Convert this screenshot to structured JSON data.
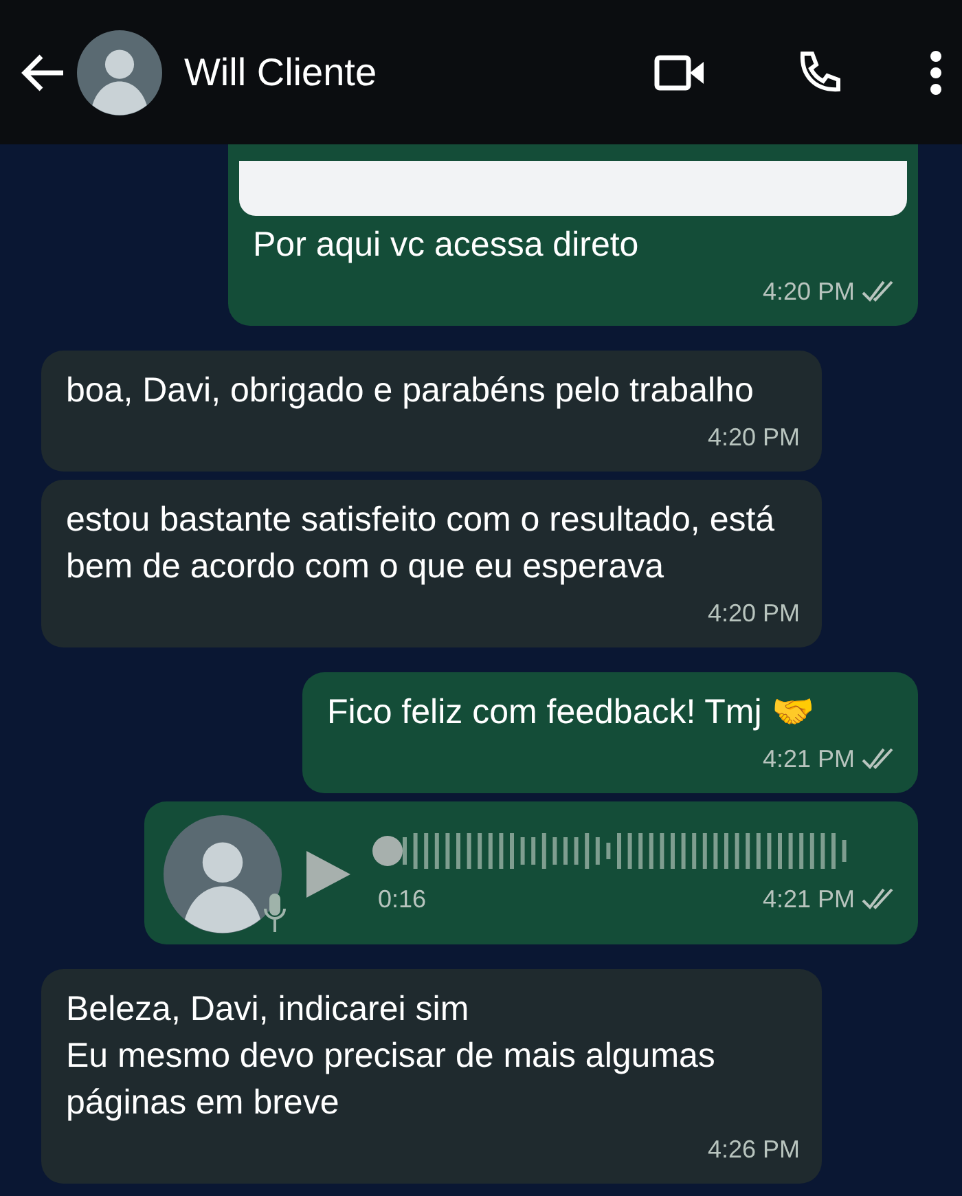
{
  "header": {
    "contact_name": "Will Cliente"
  },
  "messages": [
    {
      "kind": "link",
      "outgoing": true,
      "text": "Por aqui vc acessa direto",
      "time": "4:20 PM",
      "read": false
    },
    {
      "kind": "text",
      "outgoing": false,
      "text": "boa, Davi, obrigado e parabéns pelo trabalho",
      "time": "4:20 PM"
    },
    {
      "kind": "text",
      "outgoing": false,
      "text": "estou bastante satisfeito com o resultado, está bem de acordo com o que eu esperava",
      "time": "4:20 PM"
    },
    {
      "kind": "text",
      "outgoing": true,
      "text": "Fico feliz com feedback! Tmj 🤝",
      "time": "4:21 PM",
      "read": false
    },
    {
      "kind": "voice",
      "outgoing": true,
      "duration": "0:16",
      "time": "4:21 PM",
      "read": false
    },
    {
      "kind": "text",
      "outgoing": false,
      "text": "Beleza, Davi, indicarei sim\nEu mesmo devo precisar de mais algumas páginas em breve",
      "time": "4:26 PM"
    }
  ]
}
